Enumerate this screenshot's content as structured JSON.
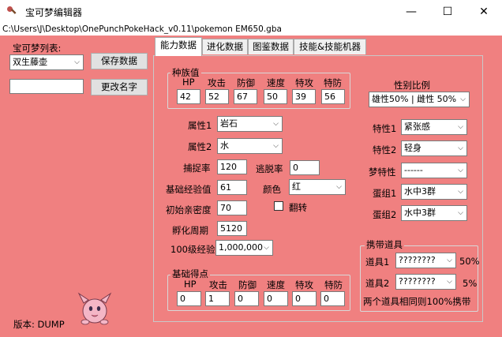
{
  "window": {
    "title": "宝可梦编辑器",
    "path": "C:\\Users\\J\\Desktop\\OnePunchPokeHack_v0.11\\pokemon EM650.gba",
    "minimize_glyph": "—",
    "maximize_glyph": "☐",
    "close_glyph": "✕"
  },
  "sidebar": {
    "list_label": "宝可梦列表:",
    "selected_pokemon": "双生藤壶",
    "save_button": "保存数据",
    "rename_input": "",
    "rename_button": "更改名字",
    "version_label": "版本: DUMP"
  },
  "tabs": [
    "能力数据",
    "进化数据",
    "图鉴数据",
    "技能&技能机器"
  ],
  "base_stats": {
    "title": "种族值",
    "headers": [
      "HP",
      "攻击",
      "防御",
      "速度",
      "特攻",
      "特防"
    ],
    "values": [
      "42",
      "52",
      "67",
      "50",
      "39",
      "56"
    ]
  },
  "gender": {
    "label": "性别比例",
    "value": "雄性50% | 雌性 50%"
  },
  "types": {
    "type1_label": "属性1",
    "type1": "岩石",
    "type2_label": "属性2",
    "type2": "水"
  },
  "catch": {
    "catch_label": "捕捉率",
    "catch_value": "120",
    "flee_label": "逃脱率",
    "flee_value": "0"
  },
  "exp": {
    "label": "基础经验值",
    "value": "61"
  },
  "color": {
    "label": "颜色",
    "value": "红"
  },
  "friendship": {
    "label": "初始亲密度",
    "value": "70"
  },
  "flip": {
    "label": "翻转",
    "checked": false
  },
  "hatch": {
    "label": "孵化周期",
    "value": "5120"
  },
  "level100": {
    "label": "100级经验",
    "value": "1,000,000"
  },
  "ev_yield": {
    "title": "基础得点",
    "headers": [
      "HP",
      "攻击",
      "防御",
      "速度",
      "特攻",
      "特防"
    ],
    "values": [
      "0",
      "1",
      "0",
      "0",
      "0",
      "0"
    ]
  },
  "abilities": {
    "ability1_label": "特性1",
    "ability1": "紧张感",
    "ability2_label": "特性2",
    "ability2": "轻身",
    "hidden_label": "梦特性",
    "hidden": "------"
  },
  "egg_groups": {
    "group1_label": "蛋组1",
    "group1": "水中3群",
    "group2_label": "蛋组2",
    "group2": "水中3群"
  },
  "held_items": {
    "title": "携带道具",
    "item1_label": "道具1",
    "item1": "????????",
    "item1_pct": "50%",
    "item2_label": "道具2",
    "item2": "????????",
    "item2_pct": "5%",
    "note": "两个道具相同则100%携带"
  },
  "colors": {
    "client_bg": "#f08080",
    "tab_active": "#ffffff"
  }
}
